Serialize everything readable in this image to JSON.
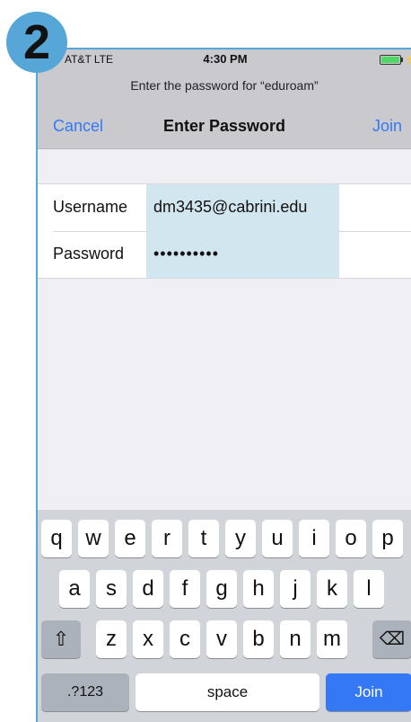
{
  "step": {
    "number": "2"
  },
  "status_bar": {
    "carrier": "AT&T  LTE",
    "time": "4:30 PM",
    "bolt": "⚡"
  },
  "prompt": "Enter the password for “eduroam”",
  "nav": {
    "cancel": "Cancel",
    "title": "Enter Password",
    "join": "Join"
  },
  "form": {
    "username_label": "Username",
    "username_value": "dm3435@cabrini.edu",
    "password_label": "Password",
    "password_value": "••••••••••"
  },
  "keyboard": {
    "row1": [
      "q",
      "w",
      "e",
      "r",
      "t",
      "y",
      "u",
      "i",
      "o",
      "p"
    ],
    "row2": [
      "a",
      "s",
      "d",
      "f",
      "g",
      "h",
      "j",
      "k",
      "l"
    ],
    "row3": [
      "z",
      "x",
      "c",
      "v",
      "b",
      "n",
      "m"
    ],
    "shift_icon": "⇧",
    "backspace_icon": "⌫",
    "mode_label": ".?123",
    "space_label": "space",
    "join_label": "Join"
  },
  "colors": {
    "accent": "#3478f6",
    "badge": "#56a7d8",
    "field_highlight": "#d2e6ef"
  }
}
